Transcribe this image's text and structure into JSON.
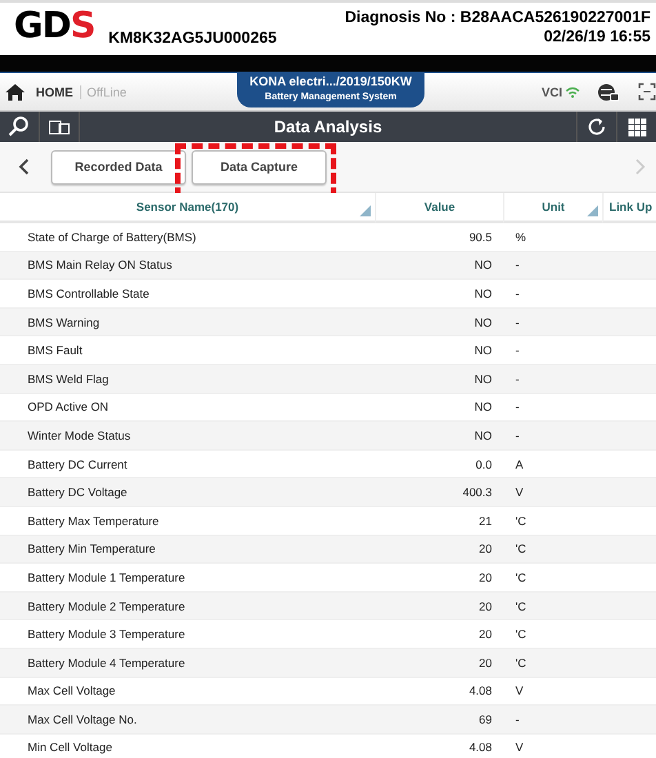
{
  "header": {
    "logo": "GDS",
    "vin": "KM8K32AG5JU000265",
    "diagnosis_no": "Diagnosis No : B28AACA526190227001F",
    "datetime": "02/26/19 16:55"
  },
  "nav": {
    "home": "HOME",
    "mode": "OffLine",
    "vehicle": "KONA electri.../2019/150KW",
    "system": "Battery Management System",
    "vci": "VCI"
  },
  "toolbar": {
    "title": "Data Analysis"
  },
  "tabs": [
    {
      "label": "Recorded Data",
      "selected": false,
      "highlighted": false
    },
    {
      "label": "Data Capture",
      "selected": false,
      "highlighted": true
    }
  ],
  "table": {
    "columns": [
      "Sensor Name(170)",
      "Value",
      "Unit",
      "Link Up"
    ],
    "rows": [
      [
        "State of Charge of Battery(BMS)",
        "90.5",
        "%"
      ],
      [
        "BMS Main Relay ON Status",
        "NO",
        "-"
      ],
      [
        "BMS Controllable State",
        "NO",
        "-"
      ],
      [
        "BMS Warning",
        "NO",
        "-"
      ],
      [
        "BMS Fault",
        "NO",
        "-"
      ],
      [
        "BMS Weld Flag",
        "NO",
        "-"
      ],
      [
        "OPD Active ON",
        "NO",
        "-"
      ],
      [
        "Winter Mode Status",
        "NO",
        "-"
      ],
      [
        "Battery DC Current",
        "0.0",
        "A"
      ],
      [
        "Battery DC Voltage",
        "400.3",
        "V"
      ],
      [
        "Battery Max Temperature",
        "21",
        "'C"
      ],
      [
        "Battery Min Temperature",
        "20",
        "'C"
      ],
      [
        "Battery Module 1 Temperature",
        "20",
        "'C"
      ],
      [
        "Battery Module 2 Temperature",
        "20",
        "'C"
      ],
      [
        "Battery Module 3 Temperature",
        "20",
        "'C"
      ],
      [
        "Battery Module 4 Temperature",
        "20",
        "'C"
      ],
      [
        "Max Cell Voltage",
        "4.08",
        "V"
      ],
      [
        "Max Cell Voltage No.",
        "69",
        "-"
      ],
      [
        "Min Cell Voltage",
        "4.08",
        "V"
      ]
    ]
  }
}
